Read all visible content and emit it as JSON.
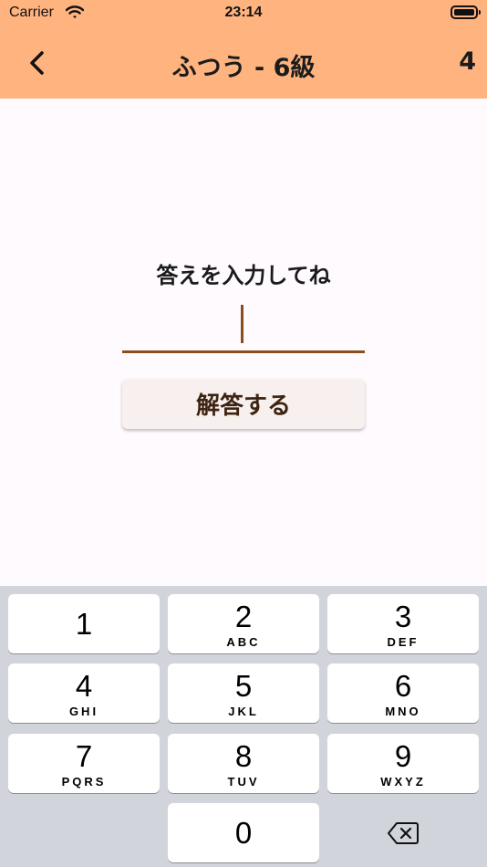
{
  "status_bar": {
    "carrier": "Carrier",
    "time": "23:14"
  },
  "nav": {
    "title": "ふつう - 6級",
    "count": "4"
  },
  "main": {
    "prompt": "答えを入力してね",
    "input_value": "",
    "submit_label": "解答する"
  },
  "keypad": {
    "keys": [
      {
        "digit": "1",
        "letters": ""
      },
      {
        "digit": "2",
        "letters": "ABC"
      },
      {
        "digit": "3",
        "letters": "DEF"
      },
      {
        "digit": "4",
        "letters": "GHI"
      },
      {
        "digit": "5",
        "letters": "JKL"
      },
      {
        "digit": "6",
        "letters": "MNO"
      },
      {
        "digit": "7",
        "letters": "PQRS"
      },
      {
        "digit": "8",
        "letters": "TUV"
      },
      {
        "digit": "9",
        "letters": "WXYZ"
      },
      {
        "digit": "0",
        "letters": ""
      }
    ]
  },
  "colors": {
    "nav_background": "#ffb37f",
    "accent": "#8a4d1e",
    "keyboard_background": "#d1d4da"
  }
}
